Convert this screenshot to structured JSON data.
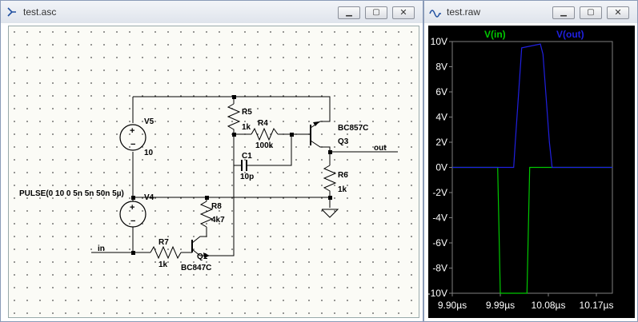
{
  "windows": {
    "schematic": {
      "title": "test.asc"
    },
    "waveform": {
      "title": "test.raw"
    }
  },
  "controls": {
    "minimize": "▁",
    "restore": "▢",
    "close": "✕"
  },
  "schematic": {
    "labels": {
      "v5_name": "V5",
      "v5_value": "10",
      "r5_name": "R5",
      "r5_value": "1k",
      "r4_name": "R4",
      "r4_value": "100k",
      "c1_name": "C1",
      "c1_value": "10p",
      "q3_model": "BC857C",
      "q3_name": "Q3",
      "out_label": "out",
      "r6_name": "R6",
      "r6_value": "1k",
      "v4_source": "PULSE(0 10 0 5n 5n 50n 5µ)",
      "v4_name": "V4",
      "r8_name": "R8",
      "r8_value": "4k7",
      "r7_name": "R7",
      "r7_value": "1k",
      "q1_name": "Q1",
      "q1_model": "BC847C",
      "in_label": "in"
    }
  },
  "colors": {
    "grid_dot": "#3a3a3a",
    "wire": "#000000",
    "plot_bg": "#000000",
    "plot_axes": "#808080",
    "trace_in": "#00c800",
    "trace_out": "#2020e0"
  },
  "chart_data": {
    "type": "line",
    "legend": [
      {
        "name": "V(in)",
        "color": "#00c800"
      },
      {
        "name": "V(out)",
        "color": "#2020e0"
      }
    ],
    "y_ticks": [
      "10V",
      "8V",
      "6V",
      "4V",
      "2V",
      "0V",
      "-2V",
      "-4V",
      "-6V",
      "-8V",
      "-10V"
    ],
    "x_ticks": [
      "9.90µs",
      "9.99µs",
      "10.08µs",
      "10.17µs"
    ],
    "xlim": [
      9.9,
      10.2
    ],
    "ylim": [
      -10,
      10
    ],
    "series": [
      {
        "name": "V(in)",
        "x": [
          9.9,
          9.985,
          9.99,
          10.04,
          10.045,
          10.2
        ],
        "y": [
          0,
          0,
          -10,
          -10,
          0,
          0
        ]
      },
      {
        "name": "V(out)",
        "x": [
          9.9,
          10.015,
          10.018,
          10.03,
          10.065,
          10.07,
          10.082,
          10.087,
          10.2
        ],
        "y": [
          0,
          0,
          2,
          9.5,
          9.8,
          9,
          2,
          0,
          0
        ]
      }
    ]
  }
}
